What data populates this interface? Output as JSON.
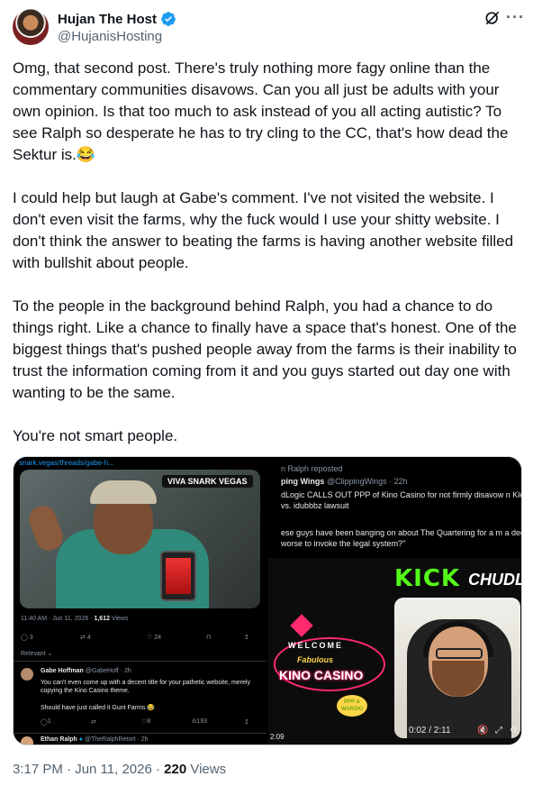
{
  "author": {
    "name": "Hujan The Host",
    "handle": "@HujanisHosting",
    "verified": true
  },
  "icons": {
    "grok": "grok-icon",
    "more": "more-icon",
    "verified": "verified-badge-icon"
  },
  "post": {
    "paragraphs": [
      "Omg, that second post. There's truly nothing more fagy online than the commentary communities disavows. Can you all just be adults with your own opinion. Is that too much to ask instead of you all acting autistic? To see Ralph so desperate he has to try cling to the CC, that's how dead the Sektur is.😂",
      "I could help but laugh at Gabe's comment. I've not visited the website. I don't even visit the farms, why the fuck would I use your shitty website. I don't think the answer to beating the farms is having another website filled with bullshit about people.",
      "To the people in the background behind Ralph, you had a chance to do things right. Like a chance to finally have a space that's honest. One of the biggest things that's pushed people away from the farms is their inability to trust the information coming from it and you guys started out day one with wanting to be the same.",
      "You're not smart people."
    ]
  },
  "media_left": {
    "url": "snark.vegas/threads/gabe-h...",
    "banner": "VIVA SNARK VEGAS",
    "meta_time": "11:40 AM · Jun 11, 2026 · ",
    "meta_views": "1,612",
    "meta_views_label": " Views",
    "actions": [
      "3",
      "4",
      "24",
      ""
    ],
    "relevant": "Relevant",
    "reply1": {
      "name": "Gabe Hoffman",
      "handle": "@GabeHoff · 2h",
      "text": "You can't even come up with a decent title for your pathetic website, merely copying the Kino Casino theme.",
      "extra": "Should have just called it Gunt Farms 😂",
      "actions": [
        "1",
        "",
        "8",
        "193"
      ]
    },
    "reply2": {
      "name": "Ethan Ralph",
      "handle": "@TheRalphRetort · 2h"
    }
  },
  "media_right": {
    "repost_label": "n Ralph reposted",
    "author": "ping Wings",
    "author_meta": "@ClippingWings · 22h",
    "body": "dLogic CALLS OUT PPP of Kino Casino for not firmly disavow n Klein vs. idubbbz lawsuit",
    "quote": "ese guys have been banging on about The Quartering for a m a degree worse to invoke the legal system?\"",
    "kick": "KICK",
    "chudlo": "CHUDL",
    "welcome": "WELCOME",
    "fabulous": "Fabulous",
    "kino": "KINO CASINO",
    "ppp": "PPP & WARSKI",
    "time_left": "2:09",
    "time_right": "0:02 / 2:11"
  },
  "footer": {
    "time": "3:17 PM · Jun 11, 2026 · ",
    "views": "220",
    "views_label": " Views"
  }
}
